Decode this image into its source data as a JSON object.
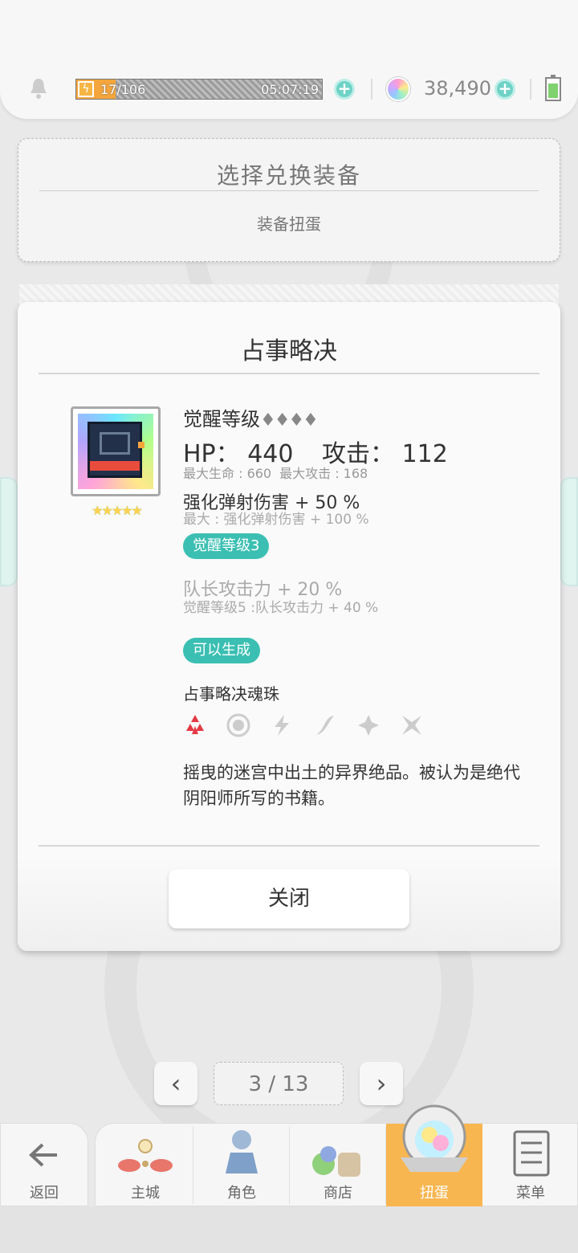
{
  "status": {
    "energy_current": "17",
    "energy_count": "17/106",
    "energy_timer": "05:07:19",
    "gems": "38,490",
    "energy_fraction": 0.16
  },
  "header": {
    "title": "选择兑换装备",
    "subtitle": "装备扭蛋"
  },
  "modal": {
    "title": "占事略决",
    "item": {
      "stars": "★★★★★",
      "awake_label": "觉醒等级",
      "awake_diamonds": "♦♦♦♦",
      "hp_label": "HP：",
      "hp_value": "440",
      "atk_label": "攻击：",
      "atk_value": "112",
      "max_hp": "最大生命 : 660",
      "max_atk": "最大攻击 : 168",
      "skill": "强化弹射伤害 + 50 %",
      "skill_max": "最大 : 强化弹射伤害 + 100 %",
      "awake_badge": "觉醒等级3",
      "leader": "队长攻击力 + 20 %",
      "leader_sub": "觉醒等级5 :队长攻击力 + 40 %",
      "gen_badge": "可以生成",
      "soul_name": "占事略决魂珠",
      "description": "摇曳的迷宫中出土的异界绝品。被认为是绝代阴阳师所写的书籍。"
    },
    "close_label": "关闭"
  },
  "pager": {
    "prev": "‹",
    "next": "›",
    "page": "3 / 13"
  },
  "nav": {
    "back": "返回",
    "items": [
      "主城",
      "角色",
      "商店",
      "扭蛋",
      "菜单"
    ],
    "active": "扭蛋"
  },
  "colors": {
    "accent_teal": "#3bbfb2",
    "active_tab": "#f8b651",
    "energy": "#f4a63c",
    "fire_element": "#e53945"
  }
}
